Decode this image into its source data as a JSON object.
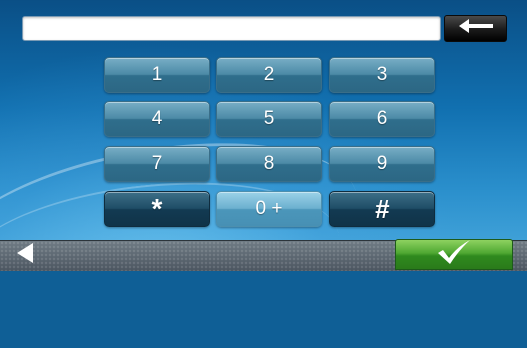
{
  "input": {
    "value": ""
  },
  "keypad": {
    "row1": [
      "1",
      "2",
      "3"
    ],
    "row2": [
      "4",
      "5",
      "6"
    ],
    "row3": [
      "7",
      "8",
      "9"
    ],
    "row4": [
      "*",
      "0 +",
      "#"
    ]
  },
  "icons": {
    "backspace": "left-arrow-icon",
    "back": "back-triangle-icon",
    "confirm": "checkmark-icon"
  },
  "colors": {
    "confirm_button": "#4fa832",
    "key_normal": "#4c8aa6",
    "key_dark": "#1f4d66",
    "background": "#1170b0"
  }
}
